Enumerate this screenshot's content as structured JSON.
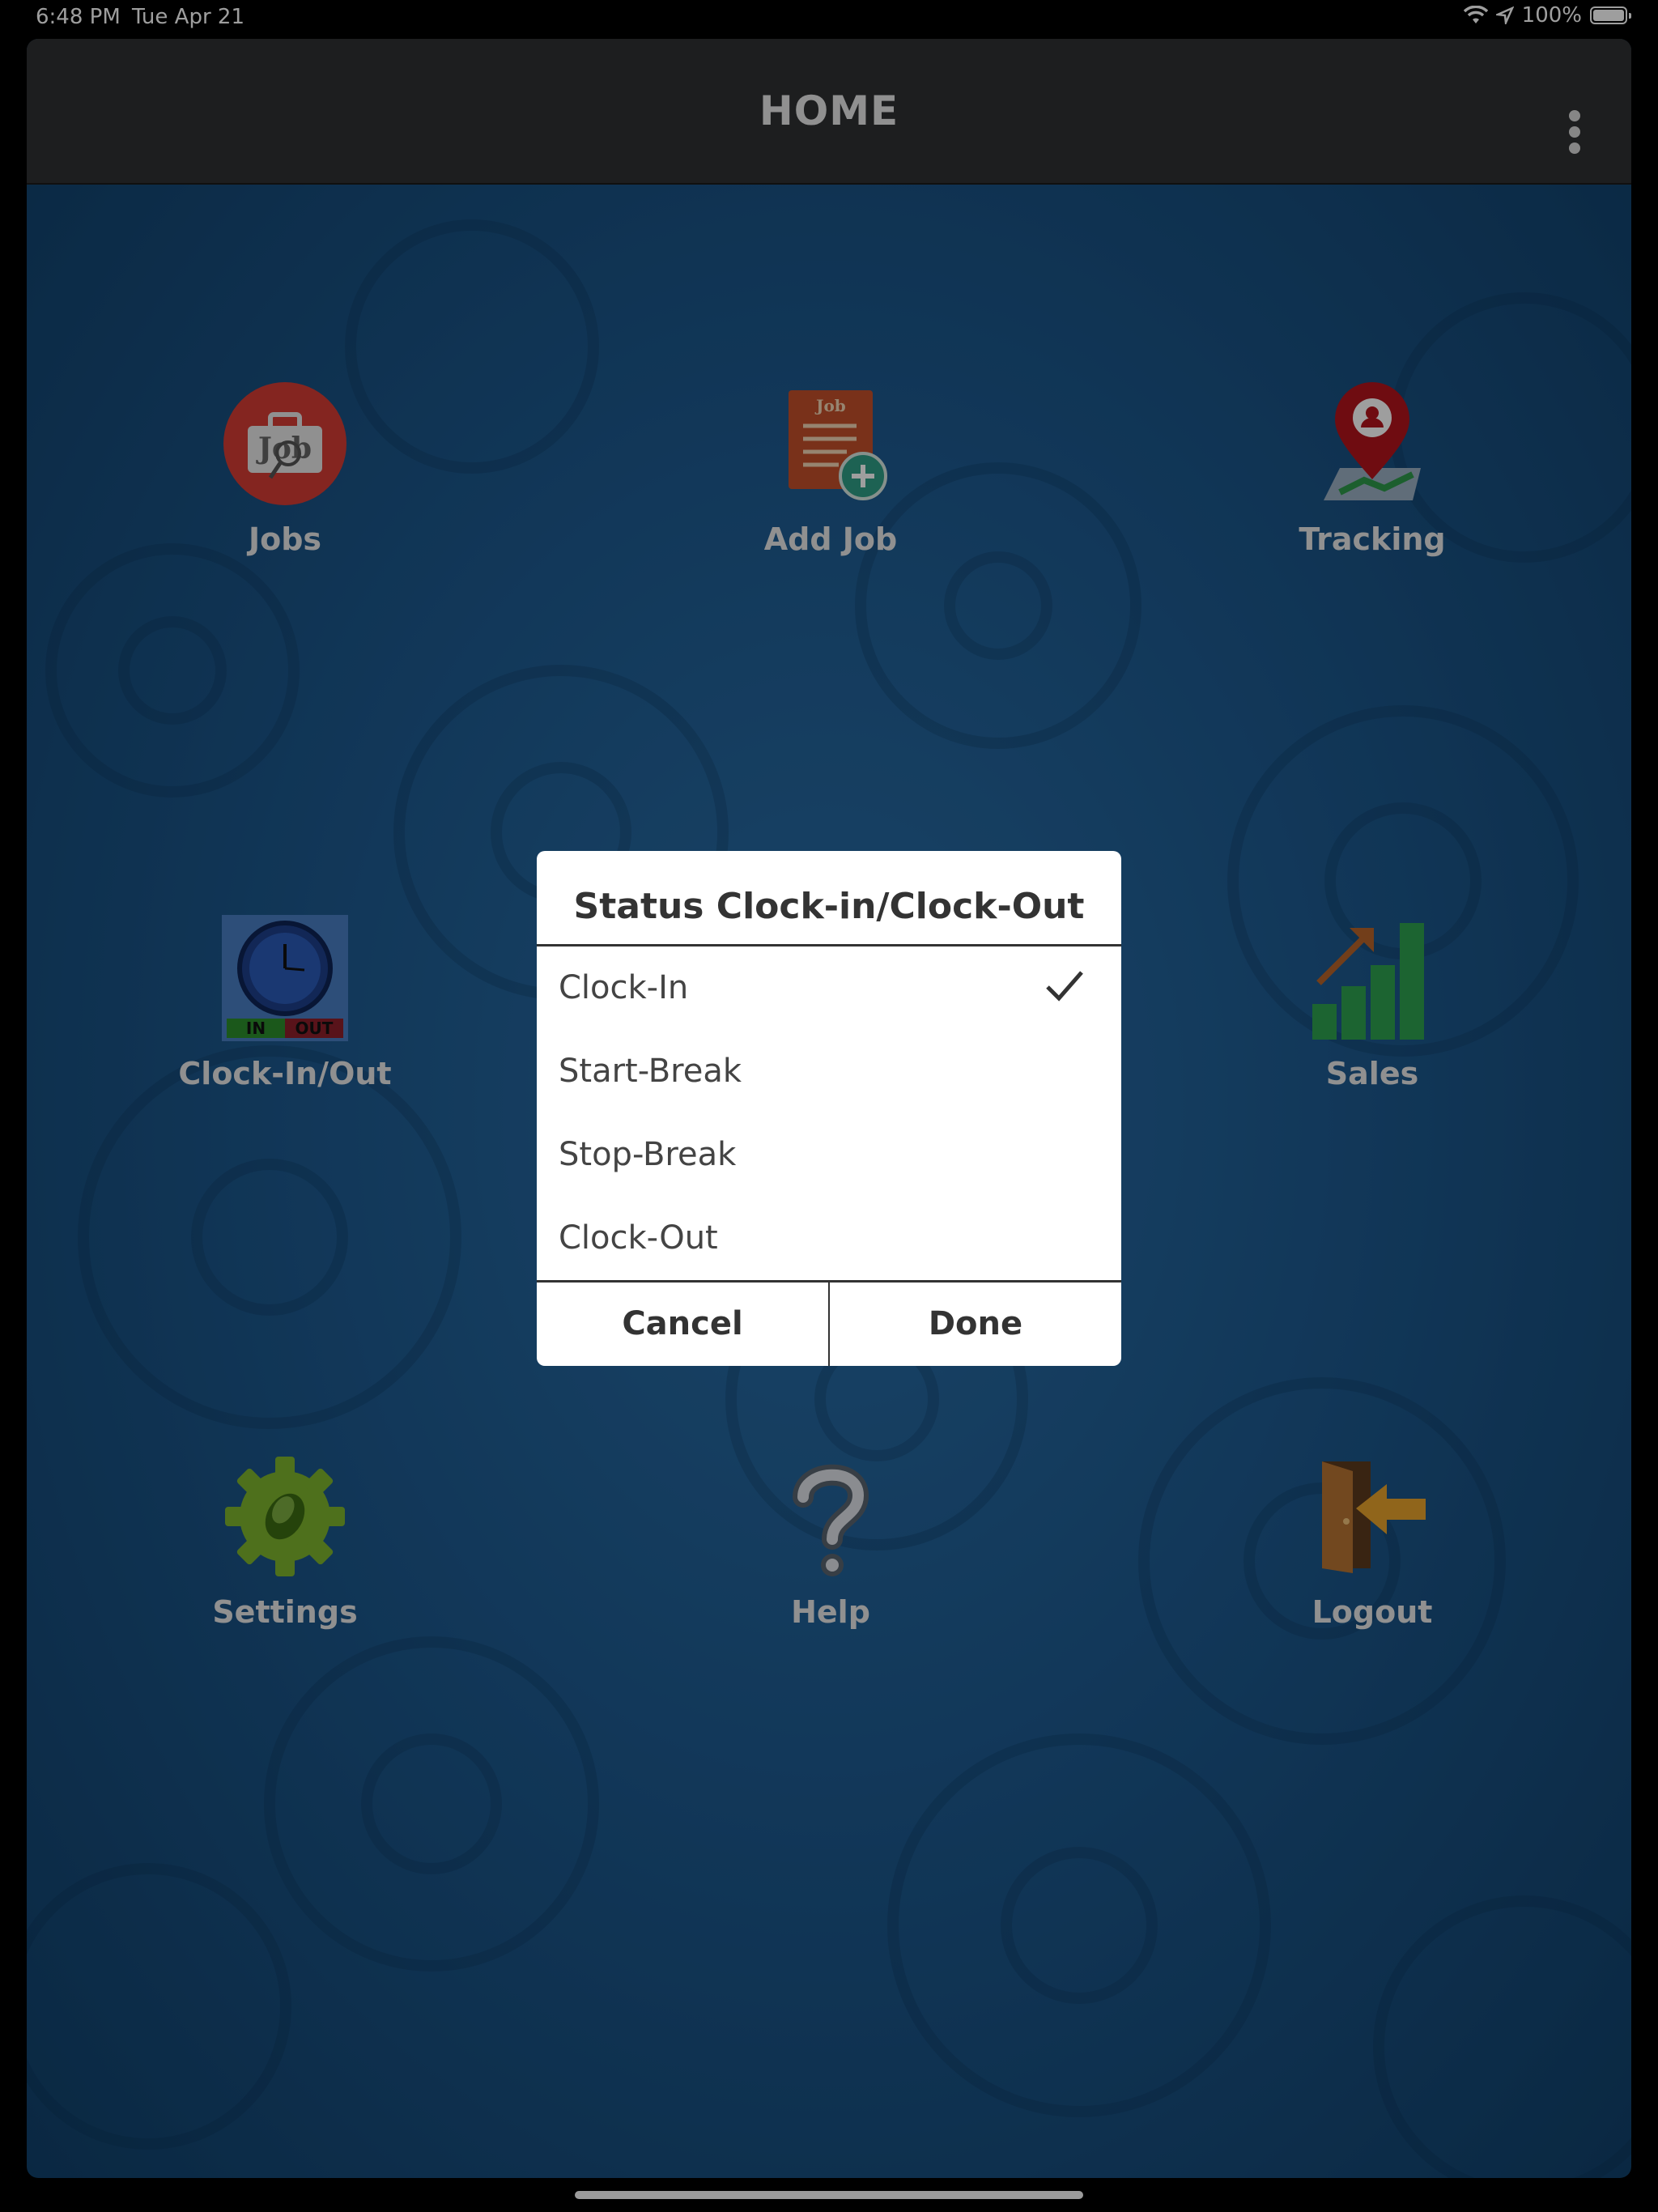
{
  "status_bar": {
    "time": "6:48 PM",
    "date": "Tue Apr 21",
    "battery": "100%"
  },
  "header": {
    "title": "HOME"
  },
  "tiles": [
    {
      "label": "Jobs"
    },
    {
      "label": "Add Job"
    },
    {
      "label": "Tracking"
    },
    {
      "label": "Clock-In/Out"
    },
    {
      "label": "Sales"
    },
    {
      "label": "Settings"
    },
    {
      "label": "Help"
    },
    {
      "label": "Logout"
    }
  ],
  "icon_text": {
    "jobs": "Job",
    "add_job": "Job",
    "clock_in": "IN",
    "clock_out": "OUT"
  },
  "dialog": {
    "title": "Status Clock-in/Clock-Out",
    "options": [
      {
        "label": "Clock-In",
        "selected": true
      },
      {
        "label": "Start-Break"
      },
      {
        "label": "Stop-Break"
      },
      {
        "label": "Clock-Out"
      }
    ],
    "cancel_label": "Cancel",
    "done_label": "Done"
  },
  "colors": {
    "header": "#2f3133",
    "background": "#1d5a90",
    "dialog": "#ffffff",
    "accent_red": "#d63c35",
    "sales_green": "#2ea24f"
  }
}
